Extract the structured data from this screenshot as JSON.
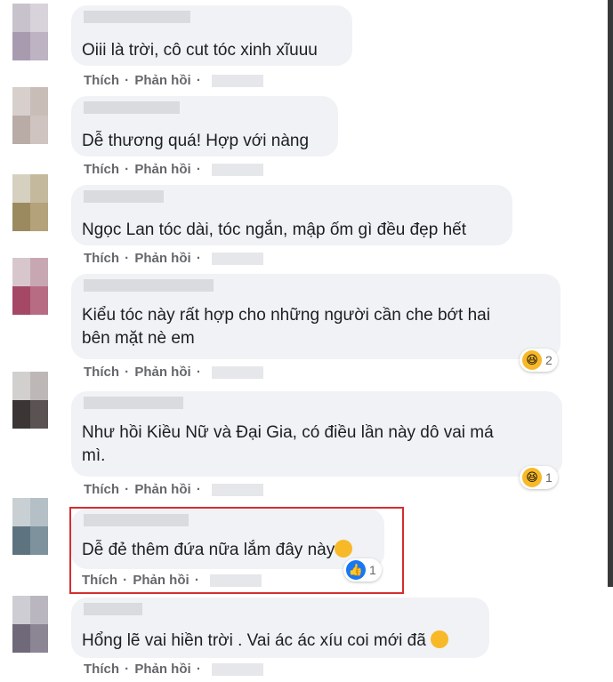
{
  "comments": [
    {
      "text": "Oiii là trời, cô cut tóc xinh xĩuuu",
      "like_label": "Thích",
      "reply_label": "Phản hồi",
      "sep": "·"
    },
    {
      "text": "Dễ thương quá! Hợp với nàng",
      "like_label": "Thích",
      "reply_label": "Phản hồi",
      "sep": "·"
    },
    {
      "text": "Ngọc Lan tóc dài, tóc ngắn, mập ốm gì đều đẹp hết",
      "like_label": "Thích",
      "reply_label": "Phản hồi",
      "sep": "·"
    },
    {
      "text_line1": "Kiểu tóc này rất hợp cho những người cần che bớt hai",
      "text_line2": "bên mặt nè em",
      "like_label": "Thích",
      "reply_label": "Phản hồi",
      "sep": "·",
      "reaction": {
        "type": "haha",
        "count": "2"
      }
    },
    {
      "text_line1": "Như hồi Kiều Nữ và Đại Gia, có điều lần này dô vai má",
      "text_line2": "mì.",
      "like_label": "Thích",
      "reply_label": "Phản hồi",
      "sep": "·",
      "reaction": {
        "type": "haha",
        "count": "1"
      }
    },
    {
      "text": "Dễ đẻ thêm đứa nữa lắm đây này",
      "like_label": "Thích",
      "reply_label": "Phản hồi",
      "sep": "·",
      "reaction": {
        "type": "like",
        "count": "1"
      }
    },
    {
      "text": "Hổng lẽ vai hiền trời . Vai ác ác xíu coi mới đã",
      "like_label": "Thích",
      "reply_label": "Phản hồi",
      "sep": "·"
    }
  ],
  "colors": {
    "bubble": "#f0f2f5",
    "action_text": "#65676b",
    "highlight": "#d32f2f",
    "like_blue": "#1877f2",
    "haha_yellow": "#f7b928"
  }
}
